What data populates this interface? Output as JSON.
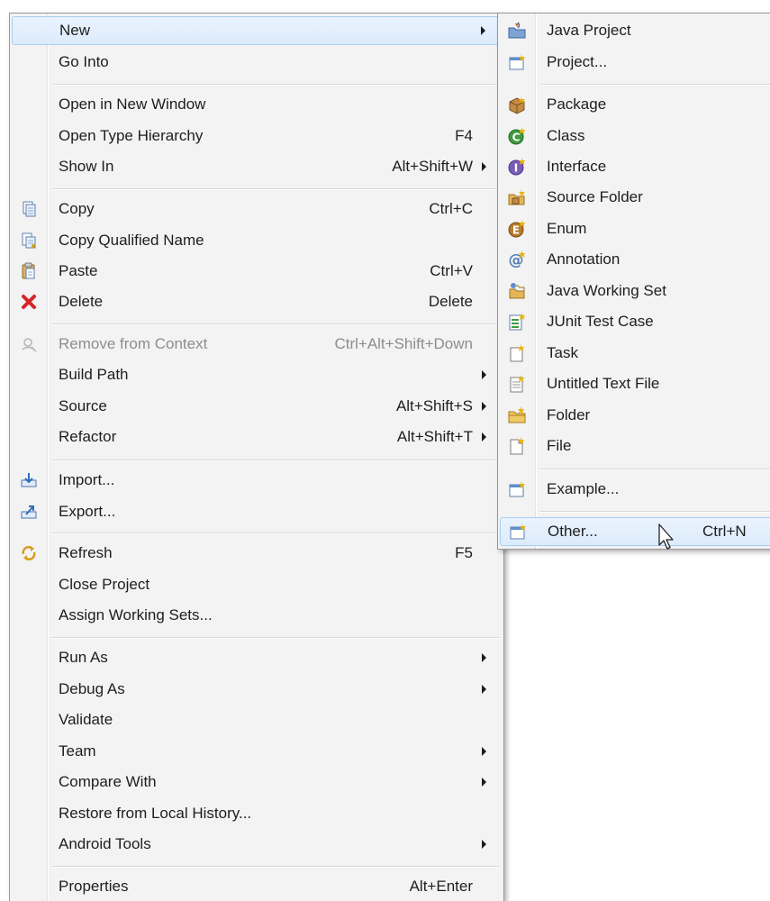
{
  "main_menu": {
    "items": [
      {
        "label": "New",
        "shortcut": "",
        "submenu": true
      },
      {
        "label": "Go Into",
        "shortcut": ""
      },
      {
        "label": "Open in New Window",
        "shortcut": ""
      },
      {
        "label": "Open Type Hierarchy",
        "shortcut": "F4"
      },
      {
        "label": "Show In",
        "shortcut": "Alt+Shift+W",
        "submenu": true
      },
      {
        "label": "Copy",
        "shortcut": "Ctrl+C",
        "icon": "copy-icon"
      },
      {
        "label": "Copy Qualified Name",
        "shortcut": "",
        "icon": "copy-qualified-name-icon"
      },
      {
        "label": "Paste",
        "shortcut": "Ctrl+V",
        "icon": "paste-icon"
      },
      {
        "label": "Delete",
        "shortcut": "Delete",
        "icon": "delete-icon"
      },
      {
        "label": "Remove from Context",
        "shortcut": "Ctrl+Alt+Shift+Down",
        "disabled": true,
        "icon": "remove-from-context-icon"
      },
      {
        "label": "Build Path",
        "shortcut": "",
        "submenu": true
      },
      {
        "label": "Source",
        "shortcut": "Alt+Shift+S",
        "submenu": true
      },
      {
        "label": "Refactor",
        "shortcut": "Alt+Shift+T",
        "submenu": true
      },
      {
        "label": "Import...",
        "shortcut": "",
        "icon": "import-icon"
      },
      {
        "label": "Export...",
        "shortcut": "",
        "icon": "export-icon"
      },
      {
        "label": "Refresh",
        "shortcut": "F5",
        "icon": "refresh-icon"
      },
      {
        "label": "Close Project",
        "shortcut": ""
      },
      {
        "label": "Assign Working Sets...",
        "shortcut": ""
      },
      {
        "label": "Run As",
        "shortcut": "",
        "submenu": true
      },
      {
        "label": "Debug As",
        "shortcut": "",
        "submenu": true
      },
      {
        "label": "Validate",
        "shortcut": ""
      },
      {
        "label": "Team",
        "shortcut": "",
        "submenu": true
      },
      {
        "label": "Compare With",
        "shortcut": "",
        "submenu": true
      },
      {
        "label": "Restore from Local History...",
        "shortcut": ""
      },
      {
        "label": "Android Tools",
        "shortcut": "",
        "submenu": true
      },
      {
        "label": "Properties",
        "shortcut": "Alt+Enter"
      }
    ]
  },
  "new_submenu": {
    "items": [
      {
        "label": "Java Project",
        "shortcut": "",
        "icon": "java-project-icon"
      },
      {
        "label": "Project...",
        "shortcut": "",
        "icon": "project-icon"
      },
      {
        "label": "Package",
        "shortcut": "",
        "icon": "package-icon"
      },
      {
        "label": "Class",
        "shortcut": "",
        "icon": "class-icon"
      },
      {
        "label": "Interface",
        "shortcut": "",
        "icon": "interface-icon"
      },
      {
        "label": "Source Folder",
        "shortcut": "",
        "icon": "source-folder-icon"
      },
      {
        "label": "Enum",
        "shortcut": "",
        "icon": "enum-icon"
      },
      {
        "label": "Annotation",
        "shortcut": "",
        "icon": "annotation-icon"
      },
      {
        "label": "Java Working Set",
        "shortcut": "",
        "icon": "java-working-set-icon"
      },
      {
        "label": "JUnit Test Case",
        "shortcut": "",
        "icon": "junit-test-case-icon"
      },
      {
        "label": "Task",
        "shortcut": "",
        "icon": "task-icon"
      },
      {
        "label": "Untitled Text File",
        "shortcut": "",
        "icon": "untitled-text-file-icon"
      },
      {
        "label": "Folder",
        "shortcut": "",
        "icon": "folder-icon"
      },
      {
        "label": "File",
        "shortcut": "",
        "icon": "file-icon"
      },
      {
        "label": "Example...",
        "shortcut": "",
        "icon": "example-icon"
      },
      {
        "label": "Other...",
        "shortcut": "Ctrl+N",
        "icon": "other-icon"
      }
    ]
  },
  "colors": {
    "menu_bg": "#f3f3f3",
    "highlight_bg": "#dcebfc",
    "highlight_border": "#a8cdf2",
    "disabled_text": "#8d8d8d"
  }
}
